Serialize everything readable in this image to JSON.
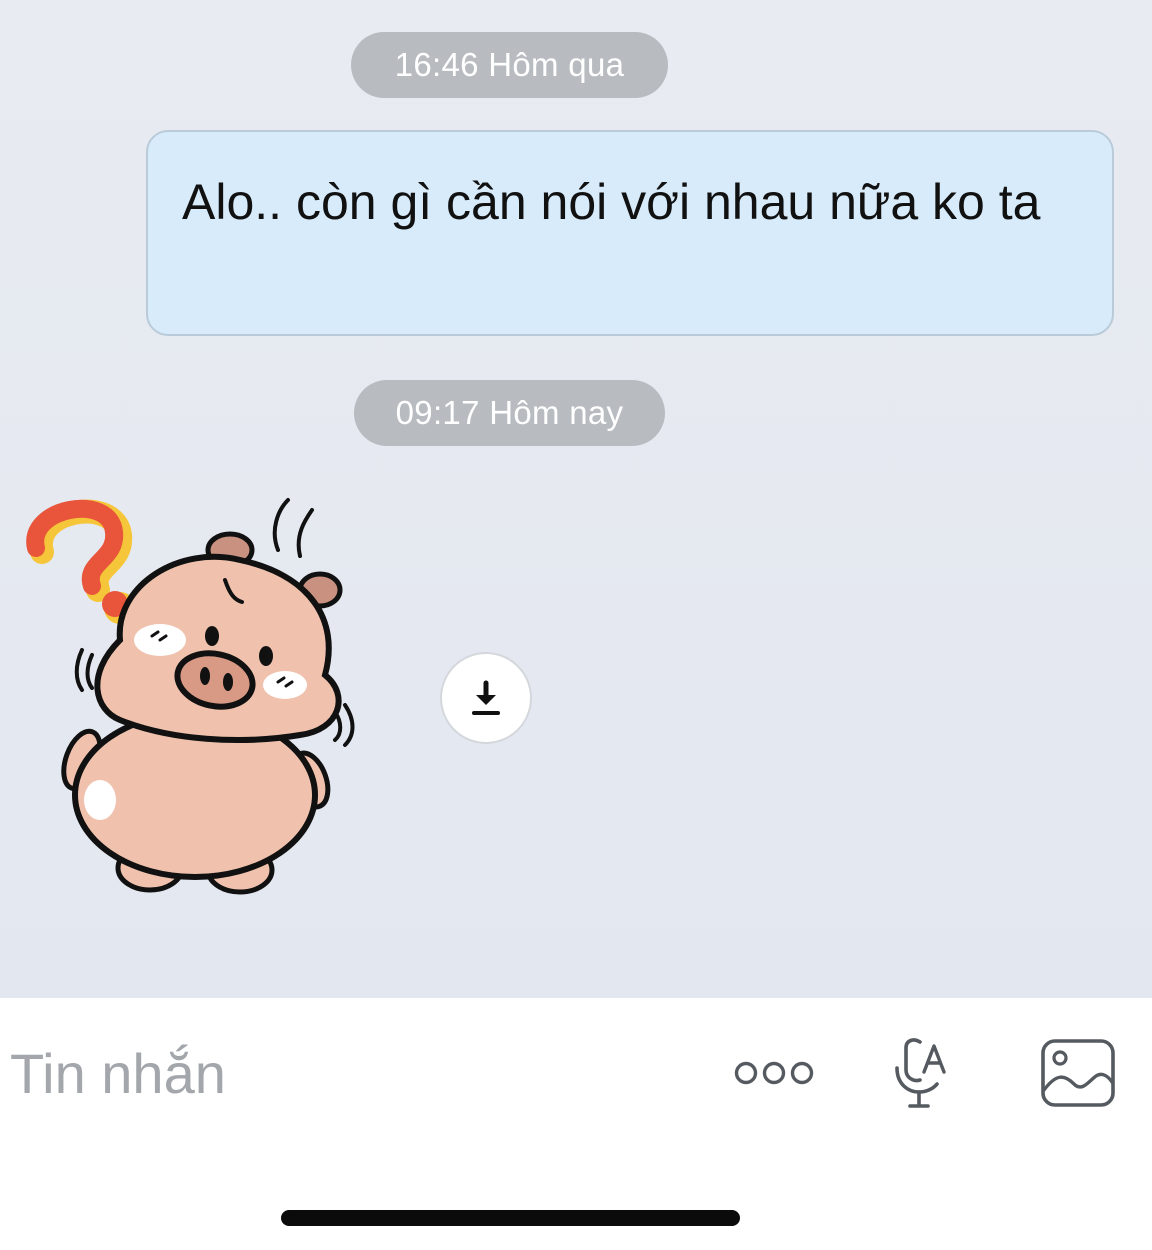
{
  "conversation": {
    "messages": [
      {
        "type": "timestamp",
        "text": "16:46 Hôm qua"
      },
      {
        "type": "outgoing",
        "text": "Alo.. còn gì cần nói với nhau nữa ko ta"
      },
      {
        "type": "timestamp",
        "text": "09:17 Hôm nay"
      },
      {
        "type": "sticker",
        "sticker": "pig-question-sticker",
        "action_icon": "download-icon"
      }
    ]
  },
  "composer": {
    "placeholder": "Tin nhắn",
    "icons": [
      "more-dots-icon",
      "voice-to-text-icon",
      "image-icon"
    ]
  },
  "colors": {
    "chat_background": "#e5e8f0",
    "outgoing_bubble": "#d7ebfa",
    "timestamp_pill": "#b8bcc1",
    "icon_gray": "#555a60"
  }
}
